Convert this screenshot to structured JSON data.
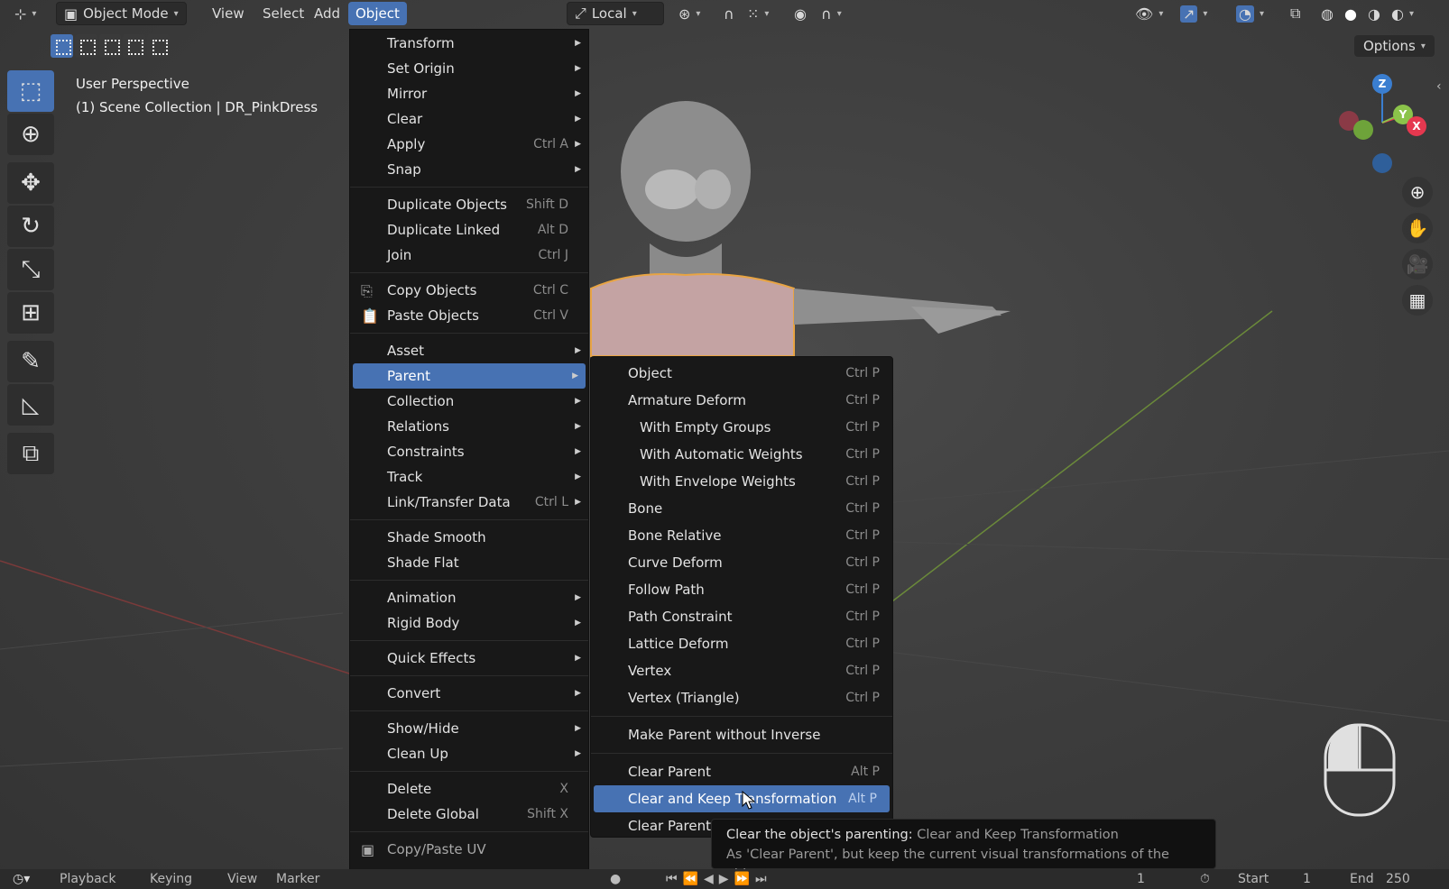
{
  "header": {
    "mode_label": "Object Mode",
    "menus": [
      "View",
      "Select",
      "Add",
      "Object"
    ],
    "active_menu": "Object",
    "transform_orientation": "Local",
    "options_label": "Options"
  },
  "view_info": {
    "line1": "User Perspective",
    "line2": "(1) Scene Collection | DR_PinkDress"
  },
  "toolbar": [
    {
      "name": "select-box-tool",
      "glyph": "⬚",
      "active": true
    },
    {
      "name": "cursor-tool",
      "glyph": "⊕"
    },
    {
      "name": "move-tool",
      "glyph": "✥"
    },
    {
      "name": "rotate-tool",
      "glyph": "↻"
    },
    {
      "name": "scale-tool",
      "glyph": "⤡"
    },
    {
      "name": "transform-tool",
      "glyph": "⊞"
    },
    {
      "name": "annotate-tool",
      "glyph": "✎"
    },
    {
      "name": "measure-tool",
      "glyph": "📐"
    },
    {
      "name": "add-cube-tool",
      "glyph": "⧉"
    }
  ],
  "object_menu": {
    "groups": [
      [
        {
          "label": "Transform",
          "arrow": true
        },
        {
          "label": "Set Origin",
          "arrow": true
        },
        {
          "label": "Mirror",
          "arrow": true
        },
        {
          "label": "Clear",
          "arrow": true
        },
        {
          "label": "Apply",
          "shortcut": "Ctrl A",
          "arrow": true
        },
        {
          "label": "Snap",
          "arrow": true
        }
      ],
      [
        {
          "label": "Duplicate Objects",
          "shortcut": "Shift D"
        },
        {
          "label": "Duplicate Linked",
          "shortcut": "Alt D"
        },
        {
          "label": "Join",
          "shortcut": "Ctrl J"
        }
      ],
      [
        {
          "label": "Copy Objects",
          "shortcut": "Ctrl C",
          "icon": "copy-icon"
        },
        {
          "label": "Paste Objects",
          "shortcut": "Ctrl V",
          "icon": "paste-icon"
        }
      ],
      [
        {
          "label": "Asset",
          "arrow": true
        },
        {
          "label": "Parent",
          "arrow": true,
          "highlighted": true
        },
        {
          "label": "Collection",
          "arrow": true
        },
        {
          "label": "Relations",
          "arrow": true
        },
        {
          "label": "Constraints",
          "arrow": true
        },
        {
          "label": "Track",
          "arrow": true
        },
        {
          "label": "Link/Transfer Data",
          "shortcut": "Ctrl L",
          "arrow": true
        }
      ],
      [
        {
          "label": "Shade Smooth"
        },
        {
          "label": "Shade Flat"
        }
      ],
      [
        {
          "label": "Animation",
          "arrow": true
        },
        {
          "label": "Rigid Body",
          "arrow": true
        }
      ],
      [
        {
          "label": "Quick Effects",
          "arrow": true
        }
      ],
      [
        {
          "label": "Convert",
          "arrow": true
        }
      ],
      [
        {
          "label": "Show/Hide",
          "arrow": true
        },
        {
          "label": "Clean Up",
          "arrow": true
        }
      ],
      [
        {
          "label": "Delete",
          "shortcut": "X"
        },
        {
          "label": "Delete Global",
          "shortcut": "Shift X"
        }
      ],
      [
        {
          "label": "Copy/Paste UV",
          "icon": "uv-icon",
          "dim": true
        },
        {
          "label": "Copy/Paste UV",
          "arrow": true
        }
      ]
    ]
  },
  "parent_submenu": {
    "groups": [
      [
        {
          "label": "Object",
          "shortcut": "Ctrl P"
        },
        {
          "label": "Armature Deform",
          "shortcut": "Ctrl P"
        },
        {
          "label": "With Empty Groups",
          "shortcut": "Ctrl P",
          "indent": true
        },
        {
          "label": "With Automatic Weights",
          "shortcut": "Ctrl P",
          "indent": true
        },
        {
          "label": "With Envelope Weights",
          "shortcut": "Ctrl P",
          "indent": true
        },
        {
          "label": "Bone",
          "shortcut": "Ctrl P"
        },
        {
          "label": "Bone Relative",
          "shortcut": "Ctrl P"
        },
        {
          "label": "Curve Deform",
          "shortcut": "Ctrl P"
        },
        {
          "label": "Follow Path",
          "shortcut": "Ctrl P"
        },
        {
          "label": "Path Constraint",
          "shortcut": "Ctrl P"
        },
        {
          "label": "Lattice Deform",
          "shortcut": "Ctrl P"
        },
        {
          "label": "Vertex",
          "shortcut": "Ctrl P"
        },
        {
          "label": "Vertex (Triangle)",
          "shortcut": "Ctrl P"
        }
      ],
      [
        {
          "label": "Make Parent without Inverse"
        }
      ],
      [
        {
          "label": "Clear Parent",
          "shortcut": "Alt P"
        },
        {
          "label": "Clear and Keep Transformation",
          "shortcut": "Alt P",
          "highlighted": true
        },
        {
          "label": "Clear Parent I",
          "shortcut": ""
        }
      ]
    ]
  },
  "tooltip": {
    "line1_main": "Clear the object's parenting:",
    "line1_sub": "Clear and Keep Transformation",
    "line2": "As 'Clear Parent', but keep the current visual transformations of the object"
  },
  "timeline": {
    "playback": "Playback",
    "keying": "Keying",
    "view": "View",
    "marker": "Marker",
    "current_frame": "1",
    "start_label": "Start",
    "start_value": "1",
    "end_label": "End",
    "end_value": "250"
  },
  "gizmo": {
    "z": "Z",
    "y": "Y",
    "x": "X"
  },
  "colors": {
    "accent": "#4772b3",
    "menu_bg": "#181818",
    "x_axis": "#e5384f",
    "y_axis": "#8bc34a",
    "z_axis": "#3a7ed0"
  }
}
